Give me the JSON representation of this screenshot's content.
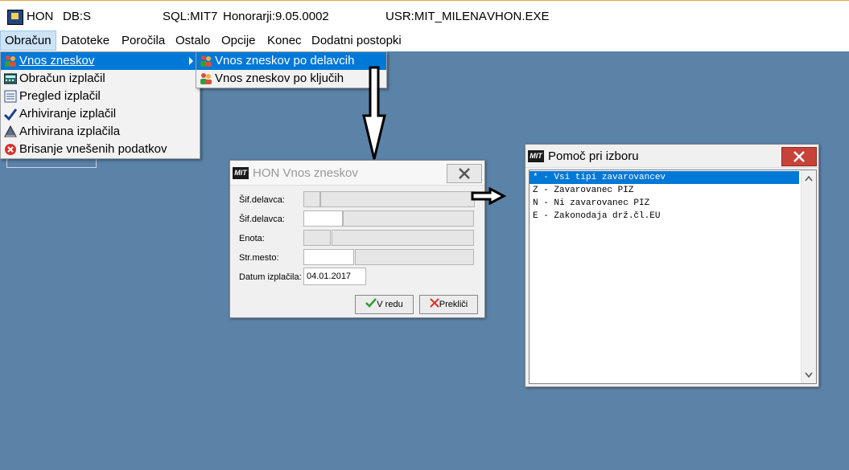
{
  "titlebar": {
    "app": "HON",
    "db": "DB:S",
    "sql": "SQL:MIT7",
    "version": "Honorarji:9.05.0002",
    "user": "USR:MIT_MILENA",
    "exe": "VHON.EXE"
  },
  "menubar": [
    "Obračun",
    "Datoteke",
    "Poročila",
    "Ostalo",
    "Opcije",
    "Konec",
    "Dodatni postopki"
  ],
  "obracun_menu": {
    "items": [
      {
        "label": "Vnos zneskov",
        "icon": "people-icon"
      },
      {
        "label": "Obračun izplačil",
        "icon": "calculator-icon"
      },
      {
        "label": "Pregled izplačil",
        "icon": "list-icon"
      },
      {
        "label": "Arhiviranje izplačil",
        "icon": "checkmark-icon"
      },
      {
        "label": "Arhivirana izplačila",
        "icon": "archive-icon"
      },
      {
        "label": "Brisanje vnešenih podatkov",
        "icon": "delete-icon"
      }
    ]
  },
  "vnos_submenu": {
    "items": [
      {
        "label": "Vnos zneskov po delavcih",
        "icon": "people-icon"
      },
      {
        "label": "Vnos zneskov po ključih",
        "icon": "people-icon"
      }
    ]
  },
  "vnos_dialog": {
    "title": "HON Vnos zneskov",
    "logo": "MIT",
    "labels": {
      "sif1": "Šif.delavca:",
      "sif2": "Šif.delavca:",
      "enota": "Enota:",
      "strmesto": "Str.mesto:",
      "datum": "Datum izplačila:"
    },
    "datum_value": "04.01.2017",
    "ok_label": "V redu",
    "cancel_label": "Prekliči"
  },
  "pomoc_dialog": {
    "title": "Pomoč pri izboru",
    "logo": "MIT",
    "items": [
      "* - Vsi tipi zavarovancev",
      "Z - Zavarovanec PIZ",
      "N - Ni zavarovanec PIZ",
      "E - Zakonodaja drž.čl.EU"
    ]
  },
  "colors": {
    "desktop": "#5b83a8",
    "selection": "#0078d7",
    "menu_active": "#cde4f7",
    "close_red": "#c8423a"
  }
}
